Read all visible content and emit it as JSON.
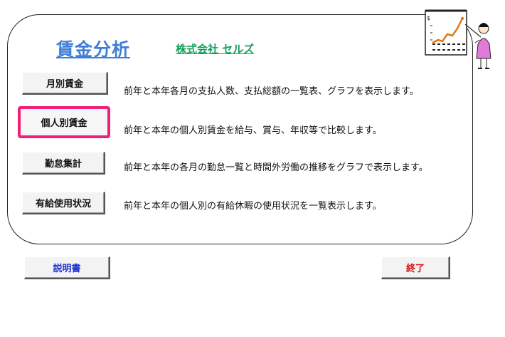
{
  "header": {
    "title": "賃金分析",
    "company": "株式会社  セルズ"
  },
  "menu": [
    {
      "label": "月別賃金",
      "description": "前年と本年各月の支払人数、支払総額の一覧表、グラフを表示します。"
    },
    {
      "label": "個人別賃金",
      "description": "前年と本年の個人別賃金を給与、賞与、年収等で比較します。"
    },
    {
      "label": "勤怠集計",
      "description": "前年と本年の各月の勤怠一覧と時間外労働の推移をグラフで表示します。"
    },
    {
      "label": "有給使用状況",
      "description": "前年と本年の個人別の有給休暇の使用状況を一覧表示します。"
    }
  ],
  "footer": {
    "manual_label": "説明書",
    "exit_label": "終了"
  },
  "colors": {
    "title": "#3f7fd6",
    "company": "#12a05a",
    "selected_border": "#f0207a",
    "manual_text": "#1c2fd6",
    "exit_text": "#e01010"
  },
  "icons": {
    "illustration": "presenter-with-rising-chart"
  }
}
